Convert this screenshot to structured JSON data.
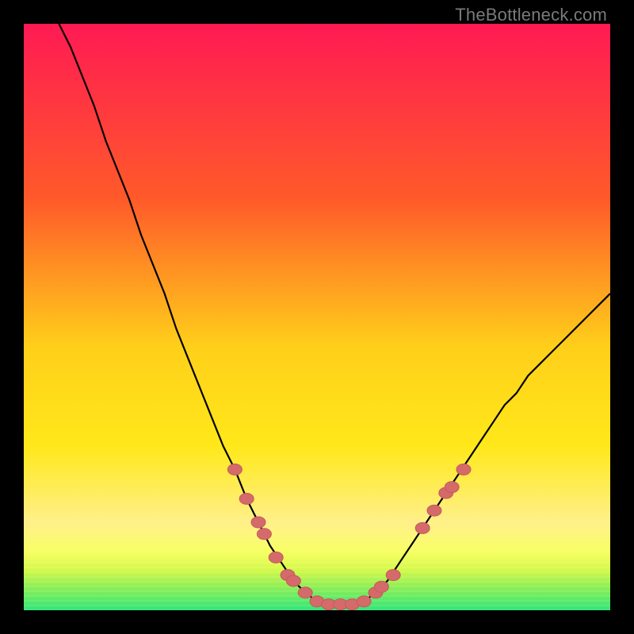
{
  "watermark": {
    "text": "TheBottleneck.com"
  },
  "colors": {
    "bg": "#000000",
    "grad_top": "#ff1a53",
    "grad_mid1": "#ff7a1f",
    "grad_mid2": "#ffe81a",
    "grad_low": "#f8ff66",
    "grad_bottom": "#32e67a",
    "curve": "#000000",
    "marker": "#d46a6a",
    "marker_edge": "#c85a5a"
  },
  "chart_data": {
    "type": "line",
    "title": "",
    "xlabel": "",
    "ylabel": "",
    "xlim": [
      0,
      100
    ],
    "ylim": [
      0,
      100
    ],
    "series": [
      {
        "name": "bottleneck-curve",
        "x": [
          6,
          8,
          10,
          12,
          14,
          16,
          18,
          20,
          22,
          24,
          26,
          28,
          30,
          32,
          34,
          36,
          38,
          40,
          42,
          44,
          46,
          48,
          50,
          52,
          54,
          56,
          58,
          60,
          62,
          64,
          66,
          68,
          70,
          72,
          74,
          76,
          78,
          80,
          82,
          84,
          86,
          88,
          90,
          92,
          94,
          96,
          98,
          100
        ],
        "y": [
          100,
          96,
          91,
          86,
          80,
          75,
          70,
          64,
          59,
          54,
          48,
          43,
          38,
          33,
          28,
          24,
          19,
          15,
          11,
          8,
          5,
          3,
          1.5,
          1,
          1,
          1,
          1.5,
          3,
          5,
          8,
          11,
          14,
          17,
          20,
          23,
          26,
          29,
          32,
          35,
          37,
          40,
          42,
          44,
          46,
          48,
          50,
          52,
          54
        ]
      }
    ],
    "markers": [
      {
        "x": 36,
        "y": 24
      },
      {
        "x": 38,
        "y": 19
      },
      {
        "x": 40,
        "y": 15
      },
      {
        "x": 41,
        "y": 13
      },
      {
        "x": 43,
        "y": 9
      },
      {
        "x": 45,
        "y": 6
      },
      {
        "x": 46,
        "y": 5
      },
      {
        "x": 48,
        "y": 3
      },
      {
        "x": 50,
        "y": 1.5
      },
      {
        "x": 52,
        "y": 1
      },
      {
        "x": 54,
        "y": 1
      },
      {
        "x": 56,
        "y": 1
      },
      {
        "x": 58,
        "y": 1.5
      },
      {
        "x": 60,
        "y": 3
      },
      {
        "x": 61,
        "y": 4
      },
      {
        "x": 63,
        "y": 6
      },
      {
        "x": 68,
        "y": 14
      },
      {
        "x": 70,
        "y": 17
      },
      {
        "x": 72,
        "y": 20
      },
      {
        "x": 73,
        "y": 21
      },
      {
        "x": 75,
        "y": 24
      }
    ],
    "gradient_bands": [
      {
        "y": 0,
        "color": "#32e67a"
      },
      {
        "y": 2,
        "color": "#8fef55"
      },
      {
        "y": 4,
        "color": "#d6f94a"
      },
      {
        "y": 7,
        "color": "#f8ff66"
      },
      {
        "y": 12,
        "color": "#fff08a"
      },
      {
        "y": 40,
        "color": "#ffe81a"
      },
      {
        "y": 70,
        "color": "#ff7a1f"
      },
      {
        "y": 100,
        "color": "#ff1a53"
      }
    ]
  }
}
